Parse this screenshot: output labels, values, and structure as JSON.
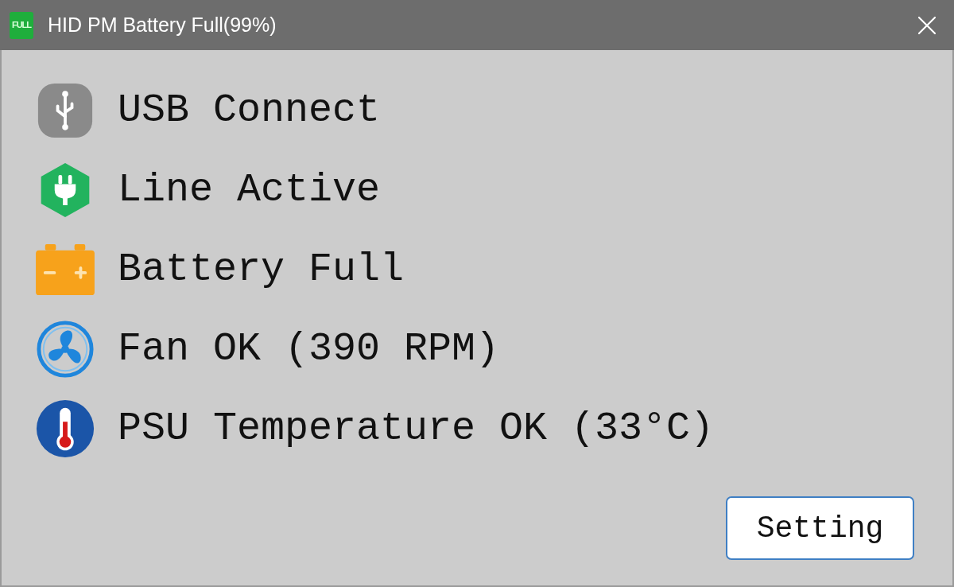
{
  "window": {
    "app_icon_label": "FULL",
    "title": "HID PM Battery Full(99%)"
  },
  "statuses": [
    {
      "kind": "usb",
      "text": "USB Connect"
    },
    {
      "kind": "line",
      "text": "Line Active"
    },
    {
      "kind": "battery",
      "text": "Battery Full"
    },
    {
      "kind": "fan",
      "text": "Fan OK (390 RPM)"
    },
    {
      "kind": "temperature",
      "text": "PSU Temperature OK (33°C)"
    }
  ],
  "buttons": [
    "Setting"
  ]
}
